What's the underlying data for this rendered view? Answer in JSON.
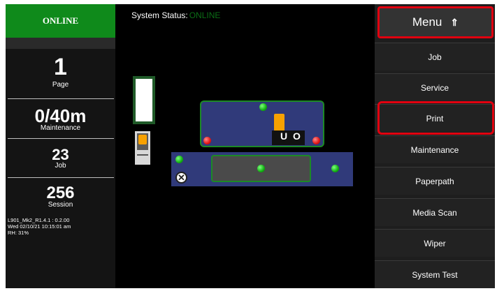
{
  "status_panel": {
    "online_label": "ONLINE"
  },
  "stats": [
    {
      "value": "1",
      "label": "Page"
    },
    {
      "value": "0/40m",
      "label": "Maintenance"
    },
    {
      "value": "23",
      "label": "Job"
    },
    {
      "value": "256",
      "label": "Session"
    }
  ],
  "info": {
    "version": "L901_Mk2_R1.4.1 : 0.2.00",
    "datetime": "Wed 02/10/21 10:15:01 am",
    "humidity": "RH: 31%"
  },
  "system_status": {
    "label": "System Status:",
    "value": "ONLINE"
  },
  "menu": {
    "header_label": "Menu",
    "header_icon": "double-up-arrow-icon",
    "items": [
      "Job",
      "Service",
      "Print",
      "Maintenance",
      "Paperpath",
      "Media Scan",
      "Wiper",
      "System Test"
    ],
    "highlighted": [
      "Menu",
      "Print"
    ]
  },
  "colors": {
    "online_green": "#0f8a1b",
    "highlight_red": "#e1000f",
    "panel_blue": "#303a7a",
    "cartridge_yellow": "#f7a100"
  },
  "diagram": {
    "sensors": [
      {
        "name": "upper-top",
        "state": "green"
      },
      {
        "name": "upper-left",
        "state": "red"
      },
      {
        "name": "upper-right",
        "state": "red"
      },
      {
        "name": "lower-left",
        "state": "green"
      },
      {
        "name": "lower-center",
        "state": "green"
      },
      {
        "name": "lower-right",
        "state": "green"
      }
    ],
    "station_symbols": [
      "U",
      "O"
    ]
  }
}
